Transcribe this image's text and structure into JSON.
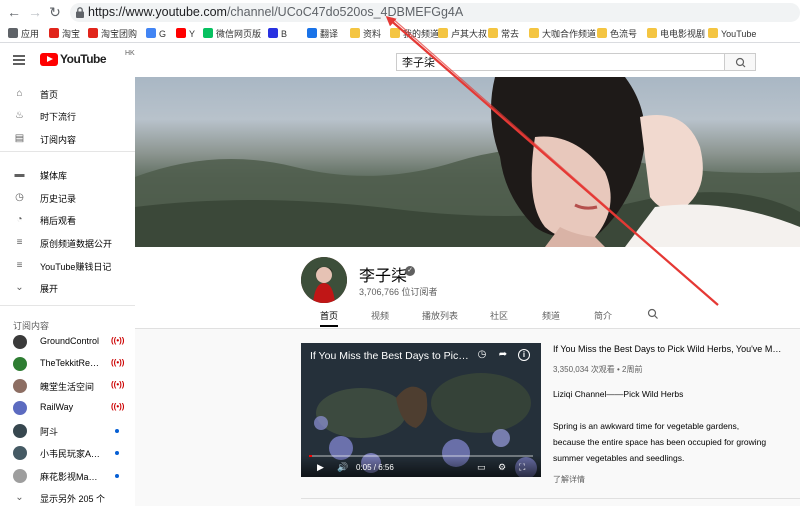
{
  "browser": {
    "url_host": "https://www.youtube.com",
    "url_path": "/channel/UCoC47do520os_4DBMEFGg4A"
  },
  "bookmarks": [
    {
      "label": "应用",
      "color": "#5f6368"
    },
    {
      "label": "淘宝",
      "color": "#e1251b"
    },
    {
      "label": "淘宝团购",
      "color": "#e1251b"
    },
    {
      "label": "G",
      "color": "#4285f4"
    },
    {
      "label": "Y",
      "color": "#ff0000"
    },
    {
      "label": "微信网页版",
      "color": "#07c160"
    },
    {
      "label": "B",
      "color": "#2932e1"
    },
    {
      "label": "翻译",
      "color": "#1a73e8"
    },
    {
      "label": "资料",
      "color": "#f4c542"
    },
    {
      "label": "我的频道",
      "color": "#f4c542"
    },
    {
      "label": "卢其大叔",
      "color": "#f4c542"
    },
    {
      "label": "常去",
      "color": "#f4c542"
    },
    {
      "label": "大咖合作频道",
      "color": "#f4c542"
    },
    {
      "label": "色流号",
      "color": "#f4c542"
    },
    {
      "label": "电电影视剧",
      "color": "#f4c542"
    },
    {
      "label": "YouTube",
      "color": "#f4c542"
    }
  ],
  "header": {
    "logo_text": "YouTube",
    "region": "HK",
    "search_value": "李子柒"
  },
  "sidebar": {
    "items": [
      {
        "label": "首页",
        "icon": "home-icon",
        "glyph": "⌂"
      },
      {
        "label": "时下流行",
        "icon": "flame-icon",
        "glyph": "♨"
      },
      {
        "label": "订阅内容",
        "icon": "subscriptions-icon",
        "glyph": "▤"
      }
    ],
    "library": [
      {
        "label": "媒体库",
        "icon": "folder-icon",
        "glyph": "▬"
      },
      {
        "label": "历史记录",
        "icon": "history-icon",
        "glyph": "◷"
      },
      {
        "label": "稍后观看",
        "icon": "clock-icon",
        "glyph": "◔"
      },
      {
        "label": "原创频道数据公开",
        "icon": "playlist-icon",
        "glyph": "≡"
      },
      {
        "label": "YouTube赚钱日记",
        "icon": "playlist-icon",
        "glyph": "≡"
      },
      {
        "label": "展开",
        "icon": "chevron-down-icon",
        "glyph": "⌄"
      }
    ],
    "subs_heading": "订阅内容",
    "subscriptions": [
      {
        "label": "GroundControl",
        "color": "#3a3a3a",
        "indicator": "live"
      },
      {
        "label": "TheTekkitRealm",
        "color": "#2e7d32",
        "indicator": "live"
      },
      {
        "label": "魄堂生活空间",
        "color": "#8d6e63",
        "indicator": "live"
      },
      {
        "label": "RailWay",
        "color": "#5c6bc0",
        "indicator": "live"
      },
      {
        "label": "阿斗",
        "color": "#37474f",
        "indicator": "dot"
      },
      {
        "label": "小韦民玩家Aver...",
        "color": "#455a64",
        "indicator": "dot"
      },
      {
        "label": "麻花影视Mahua...",
        "color": "#9e9e9e",
        "indicator": "dot"
      }
    ],
    "show_more": "显示另外 205 个"
  },
  "channel": {
    "name": "李子柒",
    "subscribers": "3,706,766 位订阅者",
    "tabs": [
      "首页",
      "视频",
      "播放列表",
      "社区",
      "频道",
      "简介"
    ],
    "active_tab": 0
  },
  "featured_video": {
    "overlay_title": "If You Miss the Best Days to Pick ...",
    "time": "0:05 / 6:56",
    "progress": 0.012,
    "title": "If You Miss the Best Days to Pick Wild Herbs, You've Missed t...",
    "meta": "3,350,034 次观看 • 2周前",
    "description": [
      "Liziqi Channel——Pick Wild Herbs",
      "",
      "Spring is an awkward time for vegetable gardens,",
      "because the entire space has been occupied for growing",
      "summer vegetables and seedlings."
    ],
    "more": "了解详情"
  }
}
